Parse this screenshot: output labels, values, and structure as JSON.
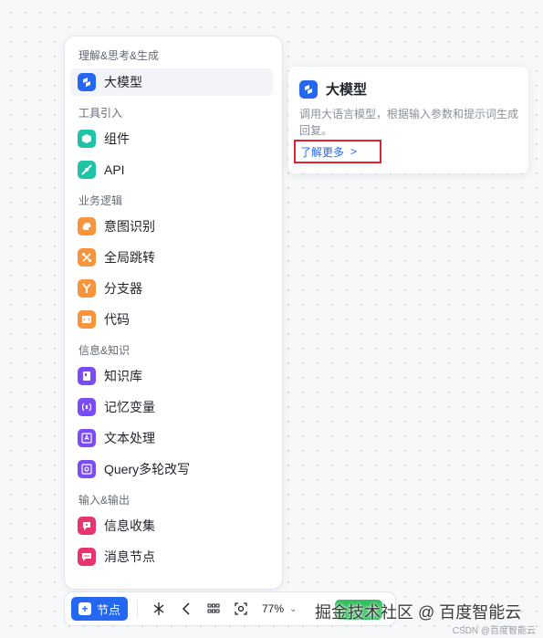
{
  "node_menu": {
    "groups": [
      {
        "title": "理解&思考&生成",
        "items": [
          {
            "label": "大模型",
            "icon": "llm-icon",
            "color": "#2468f2"
          }
        ]
      },
      {
        "title": "工具引入",
        "items": [
          {
            "label": "组件",
            "icon": "component-icon",
            "color": "#20c3a5"
          },
          {
            "label": "API",
            "icon": "api-icon",
            "color": "#20c3a5"
          }
        ]
      },
      {
        "title": "业务逻辑",
        "items": [
          {
            "label": "意图识别",
            "icon": "intent-icon",
            "color": "#f7943d"
          },
          {
            "label": "全局跳转",
            "icon": "jump-icon",
            "color": "#f7943d"
          },
          {
            "label": "分支器",
            "icon": "branch-icon",
            "color": "#f7943d"
          },
          {
            "label": "代码",
            "icon": "code-icon",
            "color": "#f7943d"
          }
        ]
      },
      {
        "title": "信息&知识",
        "items": [
          {
            "label": "知识库",
            "icon": "knowledge-base-icon",
            "color": "#7b4cf5"
          },
          {
            "label": "记忆变量",
            "icon": "variable-icon",
            "color": "#7b4cf5"
          },
          {
            "label": "文本处理",
            "icon": "text-process-icon",
            "color": "#7b4cf5"
          },
          {
            "label": "Query多轮改写",
            "icon": "query-rewrite-icon",
            "color": "#7b4cf5"
          }
        ]
      },
      {
        "title": "输入&输出",
        "items": [
          {
            "label": "信息收集",
            "icon": "collect-icon",
            "color": "#e8356d"
          },
          {
            "label": "消息节点",
            "icon": "message-icon",
            "color": "#e8356d"
          }
        ]
      }
    ]
  },
  "info_card": {
    "title": "大模型",
    "description": "调用大语言模型，根据输入参数和提示词生成回复。",
    "link_label": "了解更多",
    "link_chevron": ">"
  },
  "toolbar": {
    "add_node_label": "节点",
    "zoom_level": "77%"
  },
  "watermark": "掘金技术社区 @ 百度智能云",
  "csdn_mark": "CSDN @百度智能云"
}
